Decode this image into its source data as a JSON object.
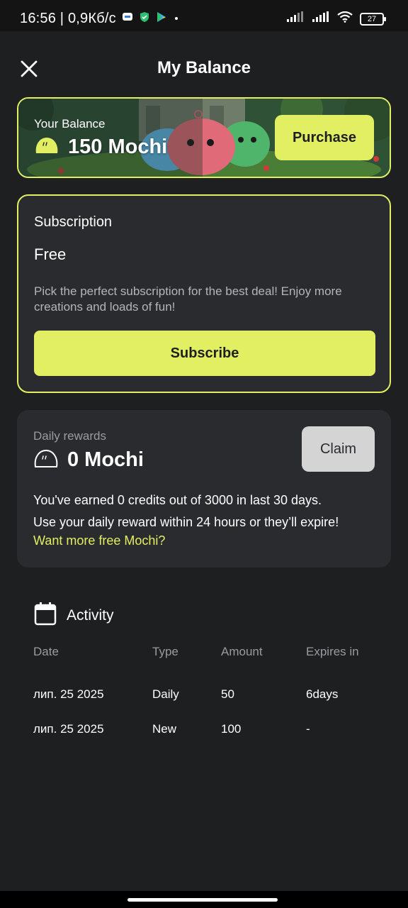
{
  "status_bar": {
    "time": "16:56 | 0,9Кб/с",
    "battery": "27",
    "icons": [
      "messages-icon",
      "shield-icon",
      "play-store-icon",
      "dot-icon",
      "signal-icon",
      "signal-icon",
      "wifi-icon",
      "battery-icon"
    ]
  },
  "header": {
    "title": "My Balance",
    "close_icon": "close-icon"
  },
  "balance": {
    "label": "Your Balance",
    "value": "150 Mochi",
    "purchase_label": "Purchase",
    "icon": "mochi-icon"
  },
  "subscription": {
    "title": "Subscription",
    "plan": "Free",
    "description": "Pick the perfect subscription for the best deal! Enjoy more creations and loads of fun!",
    "button_label": "Subscribe"
  },
  "daily": {
    "label": "Daily rewards",
    "value": "0 Mochi",
    "claim_label": "Claim",
    "info_line1": "You've earned 0 credits out of 3000 in last 30 days.",
    "info_line2": "Use your daily reward within 24 hours or they’ll expire!",
    "link": "Want more free Mochi?"
  },
  "activity": {
    "title": "Activity",
    "icon": "calendar-icon",
    "columns": [
      "Date",
      "Type",
      "Amount",
      "Expires in"
    ],
    "rows": [
      [
        "лип. 25 2025",
        "Daily",
        "50",
        "6days"
      ],
      [
        "лип. 25 2025",
        "New",
        "100",
        "-"
      ]
    ]
  },
  "colors": {
    "accent": "#e3ef63",
    "background": "#1e1f21",
    "card": "#2a2b2e",
    "claim_button": "#d4d4d4"
  }
}
